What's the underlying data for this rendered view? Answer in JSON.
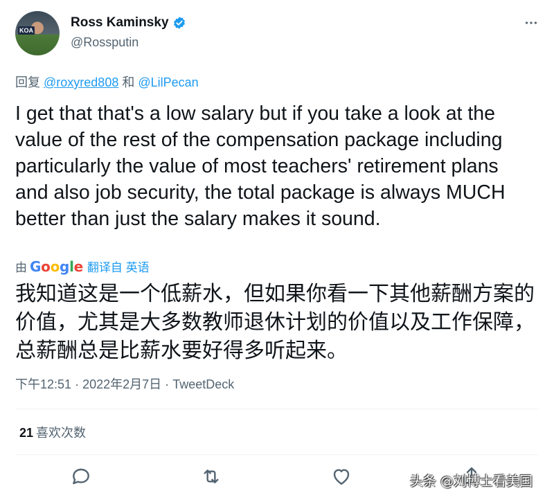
{
  "author": {
    "name": "Ross Kaminsky",
    "handle": "@Rossputin",
    "avatar_badge": "KOA"
  },
  "menu_icon": "more-horizontal-icon",
  "reply": {
    "prefix": "回复",
    "user1": "@roxyred808",
    "joiner": "和",
    "user2": "@LilPecan"
  },
  "tweet_text": "I get that that's a low salary but if you take a look at the value of the rest of the compensation package including particularly the value of most teachers' retirement plans and also job security, the total package is always MUCH better than just the salary makes it sound.",
  "translation": {
    "by": "由",
    "provider": "Google",
    "link_label": "翻译自 英语",
    "text": "我知道这是一个低薪水，但如果你看一下其他薪酬方案的价值，尤其是大多数教师退休计划的价值以及工作保障，总薪酬总是比薪水要好得多听起来。"
  },
  "meta": {
    "time": "下午12:51",
    "sep": "·",
    "date": "2022年2月7日",
    "client": "TweetDeck"
  },
  "stats": {
    "likes_count": "21",
    "likes_label": "喜欢次数"
  },
  "actions": [
    "reply-icon",
    "retweet-icon",
    "like-icon",
    "share-icon"
  ],
  "watermark": "头条 @刘博士看美国",
  "colors": {
    "accent": "#1d9bf0",
    "text": "#0f1419",
    "secondary": "#536471"
  }
}
